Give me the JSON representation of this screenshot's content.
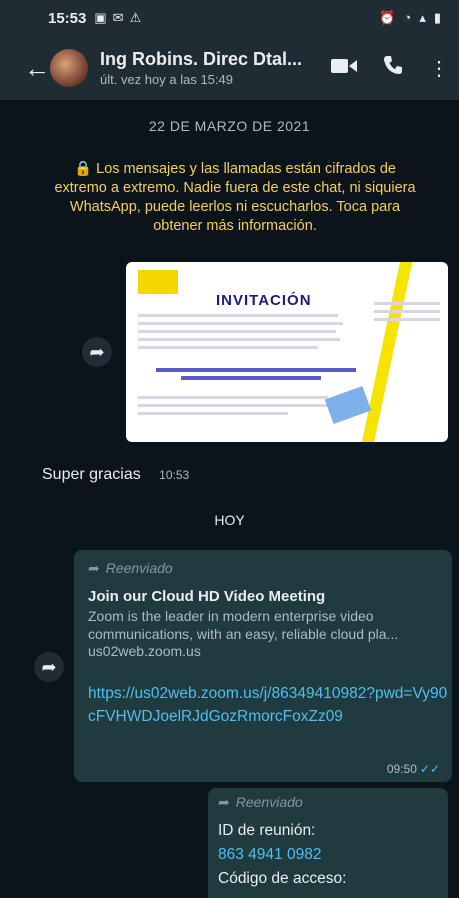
{
  "status_bar": {
    "time": "15:53",
    "left_icons": [
      "image-icon",
      "message-icon",
      "warning-icon"
    ],
    "right_icons": [
      "alarm-icon",
      "wifi-icon",
      "signal-icon",
      "battery-icon"
    ]
  },
  "header": {
    "contact_name": "Ing Robins. Direc Dtal...",
    "last_seen": "últ. vez hoy a las 15:49"
  },
  "chat": {
    "date": "22 DE MARZO DE 2021",
    "encryption_notice": "🔒 Los mensajes y las llamadas están cifrados de extremo a extremo. Nadie fuera de este chat, ni siquiera WhatsApp, puede leerlos ni escucharlos. Toca para obtener más información.",
    "image_message": {
      "title": "INVITACIÓN"
    },
    "text_message": {
      "text": "Super gracias",
      "time": "10:53"
    },
    "day_label": "HOY",
    "forwarded_message_1": {
      "label": "Reenviado",
      "preview_title": "Join our Cloud HD Video Meeting",
      "preview_desc": "Zoom is the leader in modern enterprise video communications, with an easy, reliable cloud pla...",
      "preview_domain": "us02web.zoom.us",
      "link": "https://us02web.zoom.us/j/86349410982?pwd=Vy90cFVHWDJoelRJdGozRmorcFoxZz09",
      "time": "09:50"
    },
    "forwarded_message_2": {
      "label": "Reenviado",
      "line1": "ID de reunión:",
      "line2": "863 4941 0982",
      "line3": "Código de acceso:"
    }
  },
  "colors": {
    "header_bg": "#1f2c33",
    "chat_bg": "#0b141a",
    "bubble_bg": "#1f3b3f",
    "link": "#53bdeb",
    "notice": "#f3cf5e"
  }
}
